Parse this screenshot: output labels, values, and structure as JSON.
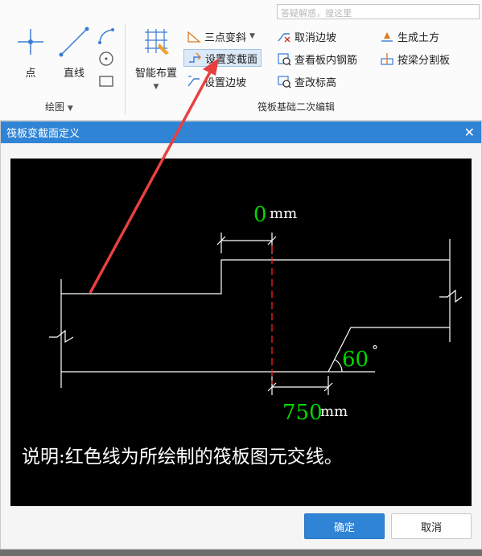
{
  "search": {
    "placeholder": "答疑解惑，搜这里"
  },
  "ribbon": {
    "draw_group": {
      "label": "绘图",
      "point_label": "点",
      "line_label": "直线"
    },
    "smart_layout": {
      "label": "智能布置"
    },
    "edit_group": {
      "label": "筏板基础二次编辑",
      "items": [
        {
          "label": "三点变斜",
          "icon": "three-point-slope-icon"
        },
        {
          "label": "设置变截面",
          "icon": "set-variable-section-icon"
        },
        {
          "label": "设置边坡",
          "icon": "set-side-slope-icon"
        },
        {
          "label": "取消边坡",
          "icon": "cancel-side-slope-icon"
        },
        {
          "label": "查看板内钢筋",
          "icon": "view-rebar-icon"
        },
        {
          "label": "查改标高",
          "icon": "edit-elevation-icon"
        },
        {
          "label": "生成土方",
          "icon": "generate-earthwork-icon"
        },
        {
          "label": "按梁分割板",
          "icon": "split-by-beam-icon"
        }
      ]
    }
  },
  "dialog": {
    "title": "筏板变截面定义",
    "canvas": {
      "offset_value": "0",
      "offset_unit": "mm",
      "width_value": "750",
      "width_unit": "mm",
      "angle_value": "60",
      "angle_unit": "°",
      "note": "说明:红色线为所绘制的筏板图元交线。"
    },
    "ok_label": "确定",
    "cancel_label": "取消"
  },
  "colors": {
    "accent": "#2f84d6",
    "drawing_value": "#00d800",
    "section_line": "#ff2020",
    "arrow": "#e84040"
  }
}
